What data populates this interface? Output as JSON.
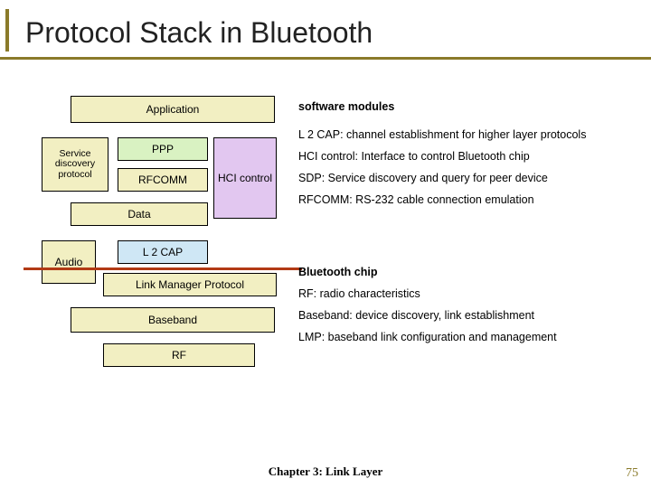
{
  "title": "Protocol Stack in Bluetooth",
  "diagram": {
    "application": "Application",
    "sdp_line1": "Service",
    "sdp_line2": "discovery",
    "sdp_line3": "protocol",
    "ppp": "PPP",
    "rfcomm": "RFCOMM",
    "hci": "HCI control",
    "data": "Data",
    "l2cap": "L 2 CAP",
    "audio": "Audio",
    "lmp": "Link Manager Protocol",
    "baseband": "Baseband",
    "rf": "RF"
  },
  "annotations": {
    "software_modules": "software modules",
    "l2cap": "L 2 CAP: channel establishment for higher layer protocols",
    "hci": "HCI control: Interface to control Bluetooth chip",
    "sdp": "SDP: Service discovery and query for peer device",
    "rfcomm": "RFCOMM: RS-232 cable connection emulation",
    "bluetooth_chip": "Bluetooth chip",
    "rf": "RF: radio characteristics",
    "baseband": "Baseband: device discovery, link establishment",
    "lmp": "LMP: baseband link configuration and management"
  },
  "footer": "Chapter 3: Link Layer",
  "page": "75"
}
